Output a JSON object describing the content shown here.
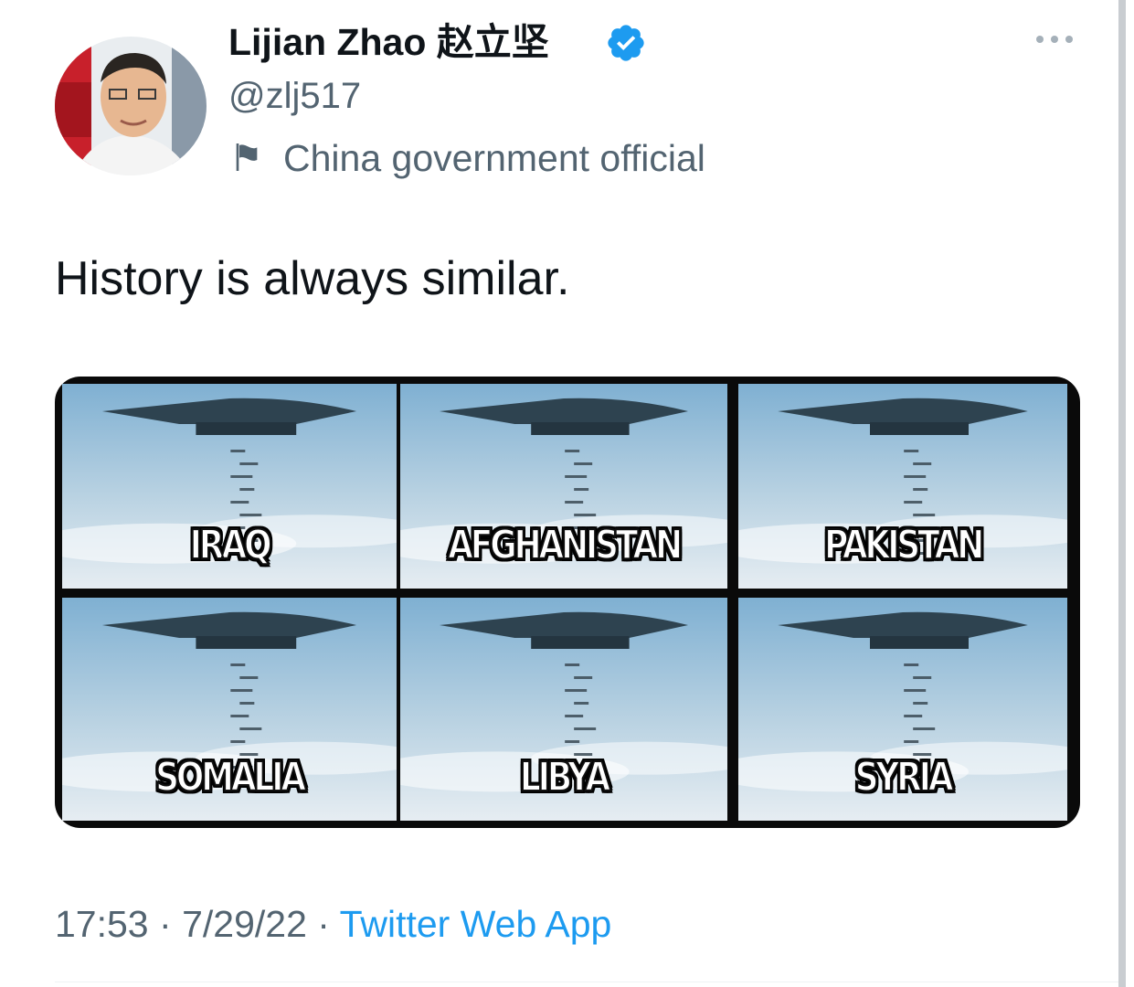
{
  "tweet": {
    "author": {
      "display_name": "Lijian Zhao",
      "display_name_cjk": "赵立坚",
      "handle": "@zlj517",
      "label": "China government official",
      "verified_icon": "verified-badge-icon",
      "label_icon": "flag-icon"
    },
    "text": "History is always similar.",
    "media": {
      "panels": [
        {
          "label": "IRAQ"
        },
        {
          "label": "AFGHANISTAN"
        },
        {
          "label": "PAKISTAN"
        },
        {
          "label": "SOMALIA"
        },
        {
          "label": "LIBYA"
        },
        {
          "label": "SYRIA"
        }
      ]
    },
    "meta": {
      "time": "17:53",
      "separator": "·",
      "date": "7/29/22",
      "source": "Twitter Web App"
    },
    "more_icon": "more-options-icon"
  },
  "colors": {
    "text_primary": "#0f1419",
    "text_secondary": "#536471",
    "link": "#1d9bf0",
    "verified": "#1d9bf0"
  }
}
